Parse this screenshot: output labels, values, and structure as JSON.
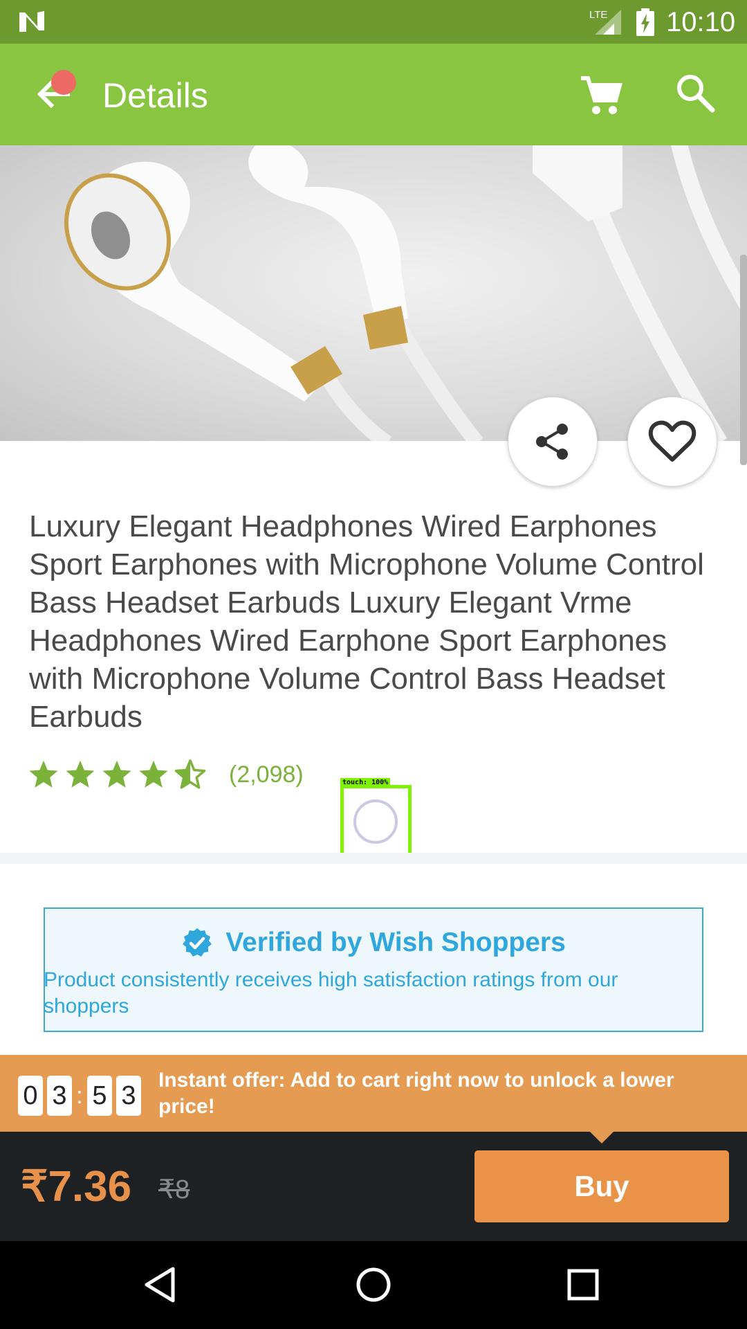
{
  "status_bar": {
    "time": "10:10",
    "network": "LTE"
  },
  "toolbar": {
    "title": "Details"
  },
  "product": {
    "title": "Luxury Elegant Headphones Wired Earphones Sport Earphones with Microphone Volume Control Bass Headset Earbuds Luxury Elegant Vrme Headphones Wired Earphone Sport Earphones with Microphone Volume Control Bass Headset Earbuds",
    "rating": 4.5,
    "rating_count": "(2,098)"
  },
  "touch_overlay": {
    "label": "touch: 100%"
  },
  "verified": {
    "title": "Verified by Wish Shoppers",
    "description": "Product consistently receives high satisfaction ratings from our shoppers"
  },
  "offer": {
    "timer": [
      "0",
      "3",
      "5",
      "3"
    ],
    "separator": ":",
    "text": "Instant offer: Add to cart right now to unlock a lower price!"
  },
  "purchase": {
    "price": "₹7.36",
    "original_price": "₹8",
    "buy_label": "Buy"
  },
  "colors": {
    "status_bar": "#6c9a2f",
    "toolbar": "#89c541",
    "star": "#7bb23a",
    "verified_blue": "#2fa7dd",
    "offer_orange": "#e59c52",
    "price_orange": "#e8914a",
    "buy_bar": "#1d2124"
  },
  "icons": {
    "back": "arrow-back-icon",
    "cart": "shopping-cart-icon",
    "search": "search-icon",
    "share": "share-icon",
    "wishlist": "heart-outline-icon",
    "verified": "verified-badge-icon"
  }
}
